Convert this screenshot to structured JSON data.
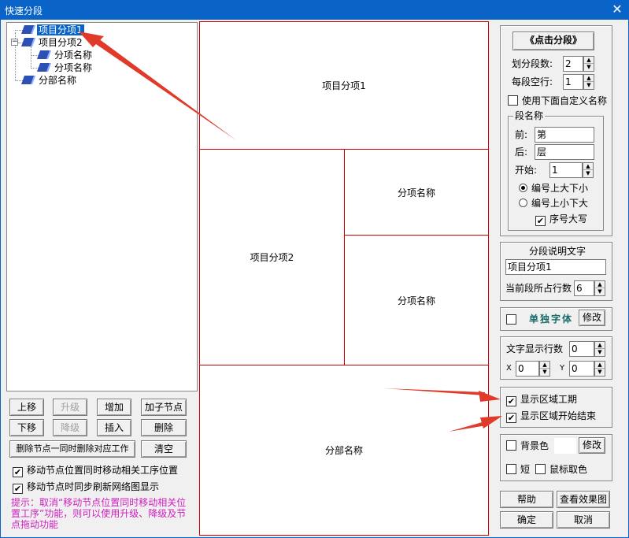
{
  "window": {
    "title": "快速分段",
    "close_glyph": "✕"
  },
  "tree": {
    "nodes": [
      {
        "label": "项目分项1",
        "selected": true
      },
      {
        "label": "项目分项2",
        "toggle": "−"
      },
      {
        "label": "分项名称"
      },
      {
        "label": "分项名称"
      },
      {
        "label": "分部名称"
      }
    ]
  },
  "buttons": {
    "move_up": "上移",
    "promote": "升级",
    "add": "增加",
    "add_child": "加子节点",
    "move_down": "下移",
    "demote": "降级",
    "insert": "插入",
    "delete": "删除",
    "delete_with_work": "删除节点一同时删除对应工作",
    "clear": "清空"
  },
  "options": {
    "move_node_with_work": {
      "label": "移动节点位置同时移动相关工序位置",
      "checked": true
    },
    "sync_refresh": {
      "label": "移动节点时同步刷新网络图显示",
      "checked": true
    }
  },
  "hint": "提示：取消“移动节点位置同时移动相关位置工序”功能，则可以使用升级、降级及节点拖动功能",
  "canvas": {
    "cells": [
      "项目分项1",
      "项目分项2",
      "分项名称",
      "分项名称",
      "分部名称"
    ]
  },
  "right": {
    "click_segment": "《点击分段》",
    "segment_count_label": "划分段数:",
    "segment_count": "2",
    "blank_rows_label": "每段空行:",
    "blank_rows": "1",
    "custom_name": {
      "label": "使用下面自定义名称",
      "checked": false
    },
    "seg_name_group": "段名称",
    "prefix_label": "前:",
    "prefix": "第",
    "suffix_label": "后:",
    "suffix": "层",
    "start_label": "开始:",
    "start": "1",
    "order_desc": {
      "label": "编号上大下小",
      "on": true
    },
    "order_asc": {
      "label": "编号上小下大",
      "on": false
    },
    "uppercase": {
      "label": "序号大写",
      "checked": true
    },
    "desc_title": "分段说明文字",
    "desc_value": "项目分项1",
    "rows_label": "当前段所占行数",
    "rows": "6",
    "font_sample": "单独字体",
    "modify": "修改",
    "text_rows_label": "文字显示行数",
    "text_rows": "0",
    "x_label": "X",
    "x_value": "0",
    "y_label": "Y",
    "y_value": "0",
    "show_duration": {
      "label": "显示区域工期",
      "checked": true
    },
    "show_start_end": {
      "label": "显示区域开始结束",
      "checked": true
    },
    "bg_color": {
      "label": "背景色",
      "checked": false
    },
    "short": {
      "label": "短",
      "checked": false
    },
    "mouse_pick": {
      "label": "鼠标取色",
      "checked": false
    },
    "help": "帮助",
    "preview": "查看效果图",
    "ok": "确定",
    "cancel": "取消"
  },
  "colors": {
    "title_bar": "#0a64c8",
    "grid_line": "#cc0000",
    "arrow": "#e03a2a",
    "hint_text": "#d020c0"
  }
}
